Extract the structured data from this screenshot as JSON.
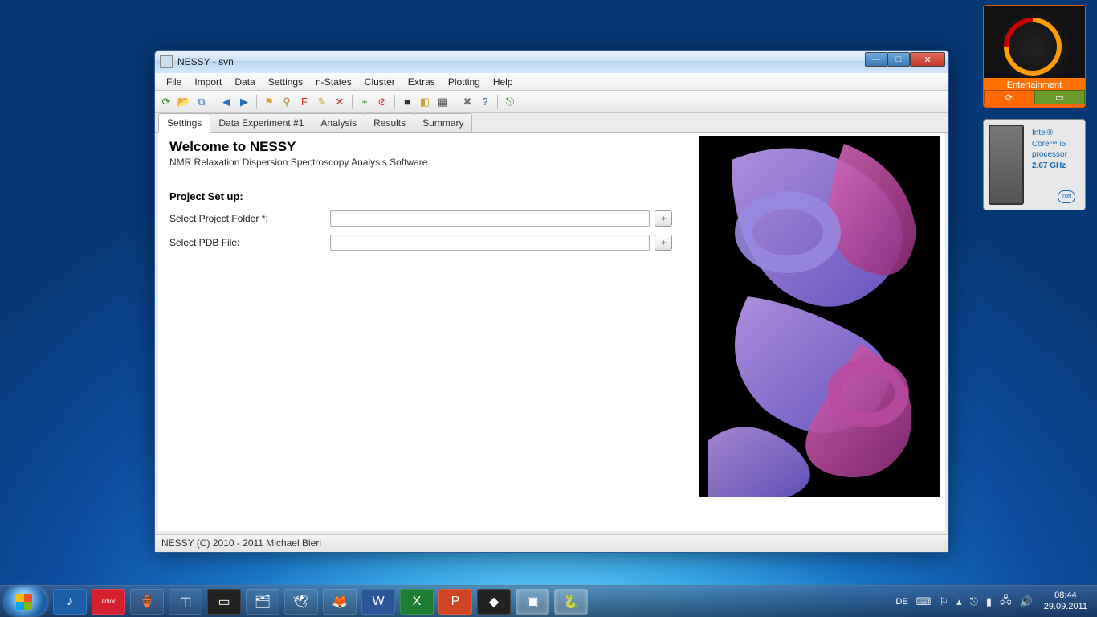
{
  "gadgets": {
    "entertainment_label": "Entertainment",
    "cpu": {
      "line1": "Intel®",
      "line2": "Core™ i5",
      "line3": "processor",
      "line4": "2.67 GHz",
      "logo": "intel"
    }
  },
  "window": {
    "title": "NESSY - svn",
    "menus": [
      "File",
      "Import",
      "Data",
      "Settings",
      "n-States",
      "Cluster",
      "Extras",
      "Plotting",
      "Help"
    ],
    "tabs": [
      "Settings",
      "Data Experiment #1",
      "Analysis",
      "Results",
      "Summary"
    ],
    "active_tab": 0,
    "settings": {
      "heading": "Welcome to NESSY",
      "subtitle": "NMR Relaxation Dispersion Spectroscopy Analysis Software",
      "section": "Project Set up:",
      "rows": [
        {
          "label": "Select Project Folder *:",
          "value": "",
          "btn": "+"
        },
        {
          "label": "Select PDB File:",
          "value": "",
          "btn": "+"
        }
      ]
    },
    "status": "NESSY (C) 2010 - 2011 Michael Bieri"
  },
  "toolbar_icons": [
    {
      "name": "refresh-icon",
      "glyph": "⟳",
      "color": "#2a8a2a"
    },
    {
      "name": "open-folder-icon",
      "glyph": "📂",
      "color": "#caa23a"
    },
    {
      "name": "copy-icon",
      "glyph": "⧉",
      "color": "#2a6db8"
    },
    {
      "sep": true
    },
    {
      "name": "back-icon",
      "glyph": "◀",
      "color": "#2a6db8"
    },
    {
      "name": "forward-icon",
      "glyph": "▶",
      "color": "#2a6db8"
    },
    {
      "sep": true
    },
    {
      "name": "flag-icon",
      "glyph": "⚑",
      "color": "#caa23a"
    },
    {
      "name": "person-icon",
      "glyph": "⚲",
      "color": "#b8862a"
    },
    {
      "name": "f-icon",
      "glyph": "F",
      "color": "#d03020"
    },
    {
      "name": "edit-icon",
      "glyph": "✎",
      "color": "#caa23a"
    },
    {
      "name": "delete-icon",
      "glyph": "✕",
      "color": "#d03020"
    },
    {
      "sep": true
    },
    {
      "name": "add-icon",
      "glyph": "+",
      "color": "#2a8a2a"
    },
    {
      "name": "remove-icon",
      "glyph": "⊘",
      "color": "#d03020"
    },
    {
      "sep": true
    },
    {
      "name": "stop-icon",
      "glyph": "■",
      "color": "#333"
    },
    {
      "name": "user-icon",
      "glyph": "◧",
      "color": "#caa23a"
    },
    {
      "name": "grid-icon",
      "glyph": "▦",
      "color": "#555"
    },
    {
      "sep": true
    },
    {
      "name": "tools-icon",
      "glyph": "✖",
      "color": "#777"
    },
    {
      "name": "help-icon",
      "glyph": "?",
      "color": "#2a6db8"
    },
    {
      "sep": true
    },
    {
      "name": "exit-icon",
      "glyph": "⎋",
      "color": "#2a8a2a"
    }
  ],
  "taskbar": {
    "apps": [
      {
        "name": "itunes-icon",
        "glyph": "♪",
        "bg": "#1a5fa8"
      },
      {
        "name": "ifolor-icon",
        "glyph": "ifolor",
        "bg": "#d62030",
        "fs": "8px"
      },
      {
        "name": "teapot-icon",
        "glyph": "🏺",
        "bg": "transparent"
      },
      {
        "name": "virtualbox-icon",
        "glyph": "◫",
        "bg": "transparent"
      },
      {
        "name": "terminal-icon",
        "glyph": "▭",
        "bg": "#222",
        "active": false
      },
      {
        "name": "explorer-icon",
        "glyph": "🗂",
        "bg": "transparent"
      },
      {
        "name": "thunderbird-icon",
        "glyph": "🕊",
        "bg": "transparent"
      },
      {
        "name": "firefox-icon",
        "glyph": "🦊",
        "bg": "transparent"
      },
      {
        "name": "word-icon",
        "glyph": "W",
        "bg": "#2a5599"
      },
      {
        "name": "excel-icon",
        "glyph": "X",
        "bg": "#1e7e34"
      },
      {
        "name": "powerpoint-icon",
        "glyph": "P",
        "bg": "#d04423"
      },
      {
        "name": "origin-icon",
        "glyph": "◆",
        "bg": "#222"
      },
      {
        "name": "gadget-app-icon",
        "glyph": "▣",
        "bg": "transparent",
        "active": true
      },
      {
        "name": "python-icon",
        "glyph": "🐍",
        "bg": "transparent",
        "active": true
      }
    ],
    "lang": "DE",
    "time": "08:44",
    "date": "29.09.2011"
  }
}
